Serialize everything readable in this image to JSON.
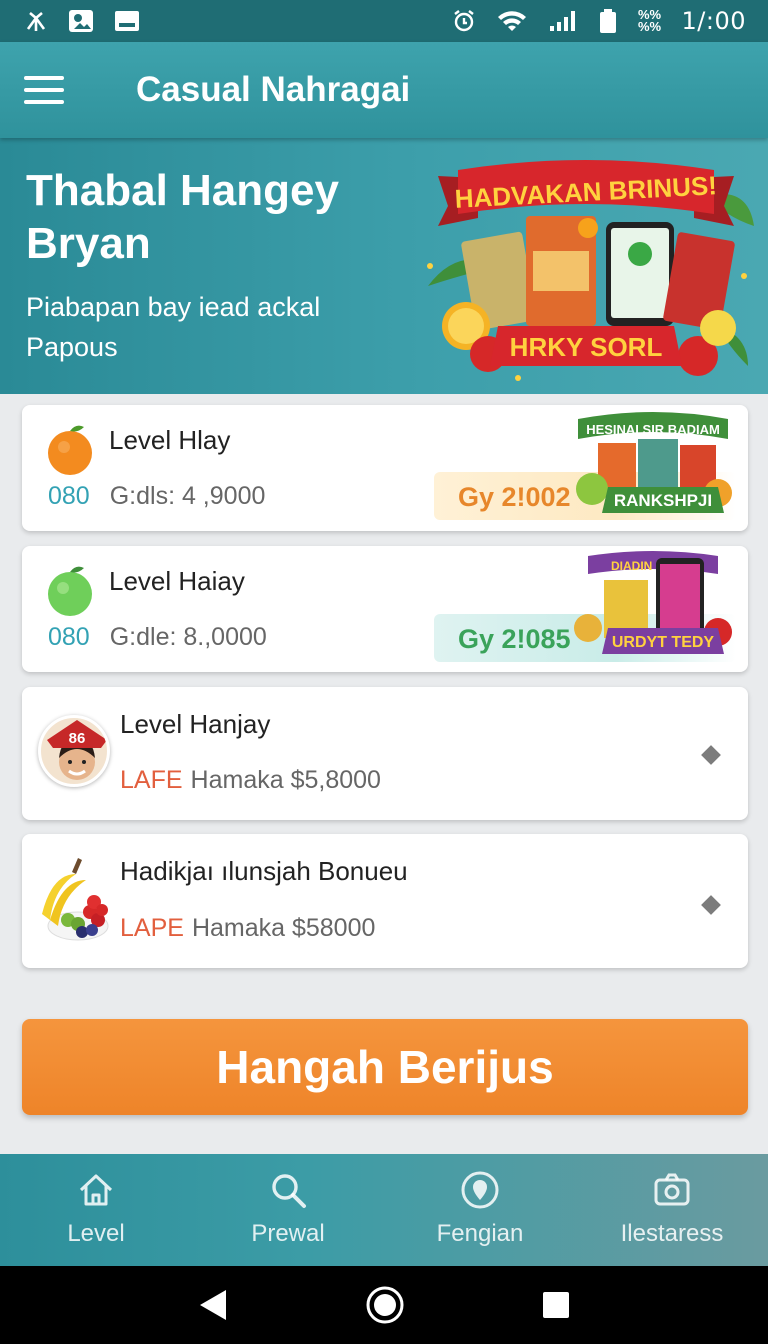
{
  "status_bar": {
    "time": "1/:00",
    "battery_text": "%%\n%%"
  },
  "app_bar": {
    "title": "Casual Nahragai"
  },
  "hero": {
    "title": "Thabal Hangey Bryan",
    "subtitle": "Piabapan bay iead ackal Papous",
    "banner_top": "HADVAKAN BRINUS!",
    "banner_bottom": "HRKY SORL"
  },
  "cards": [
    {
      "title": "Level Hlay",
      "stat": "080",
      "detail": "G:dls: 4 ,9000",
      "price": "Gy 2!002",
      "promo_top": "HESINAI SIR BADIAM",
      "promo_bottom": "RANKSHPJI",
      "fruit": "orange"
    },
    {
      "title": "Level Haiay",
      "stat": "080",
      "detail": "G:dle: 8.,0000",
      "price": "Gy 2!085",
      "promo_top": "DIADIN BUMIA",
      "promo_bottom": "URDYT TEDY",
      "fruit": "apple"
    },
    {
      "title": "Level Hanjay",
      "tag": "LAFE",
      "detail": "Hamaka $5,8000",
      "avatar_badge": "86"
    },
    {
      "title": "Hadikjaı ılunsjah Bonueu",
      "tag": "LAPE",
      "detail": "Hamaka $58000"
    }
  ],
  "cta": {
    "label": "Hangah Berijus"
  },
  "bottom_nav": [
    {
      "label": "Level",
      "icon": "home-icon"
    },
    {
      "label": "Prewal",
      "icon": "search-icon"
    },
    {
      "label": "Fengian",
      "icon": "location-pin-icon"
    },
    {
      "label": "Ilestaress",
      "icon": "camera-icon"
    }
  ],
  "colors": {
    "teal": "#2f929c",
    "orange": "#ee8429",
    "accent_red": "#e25f3e",
    "stat_blue": "#33a2b4"
  }
}
